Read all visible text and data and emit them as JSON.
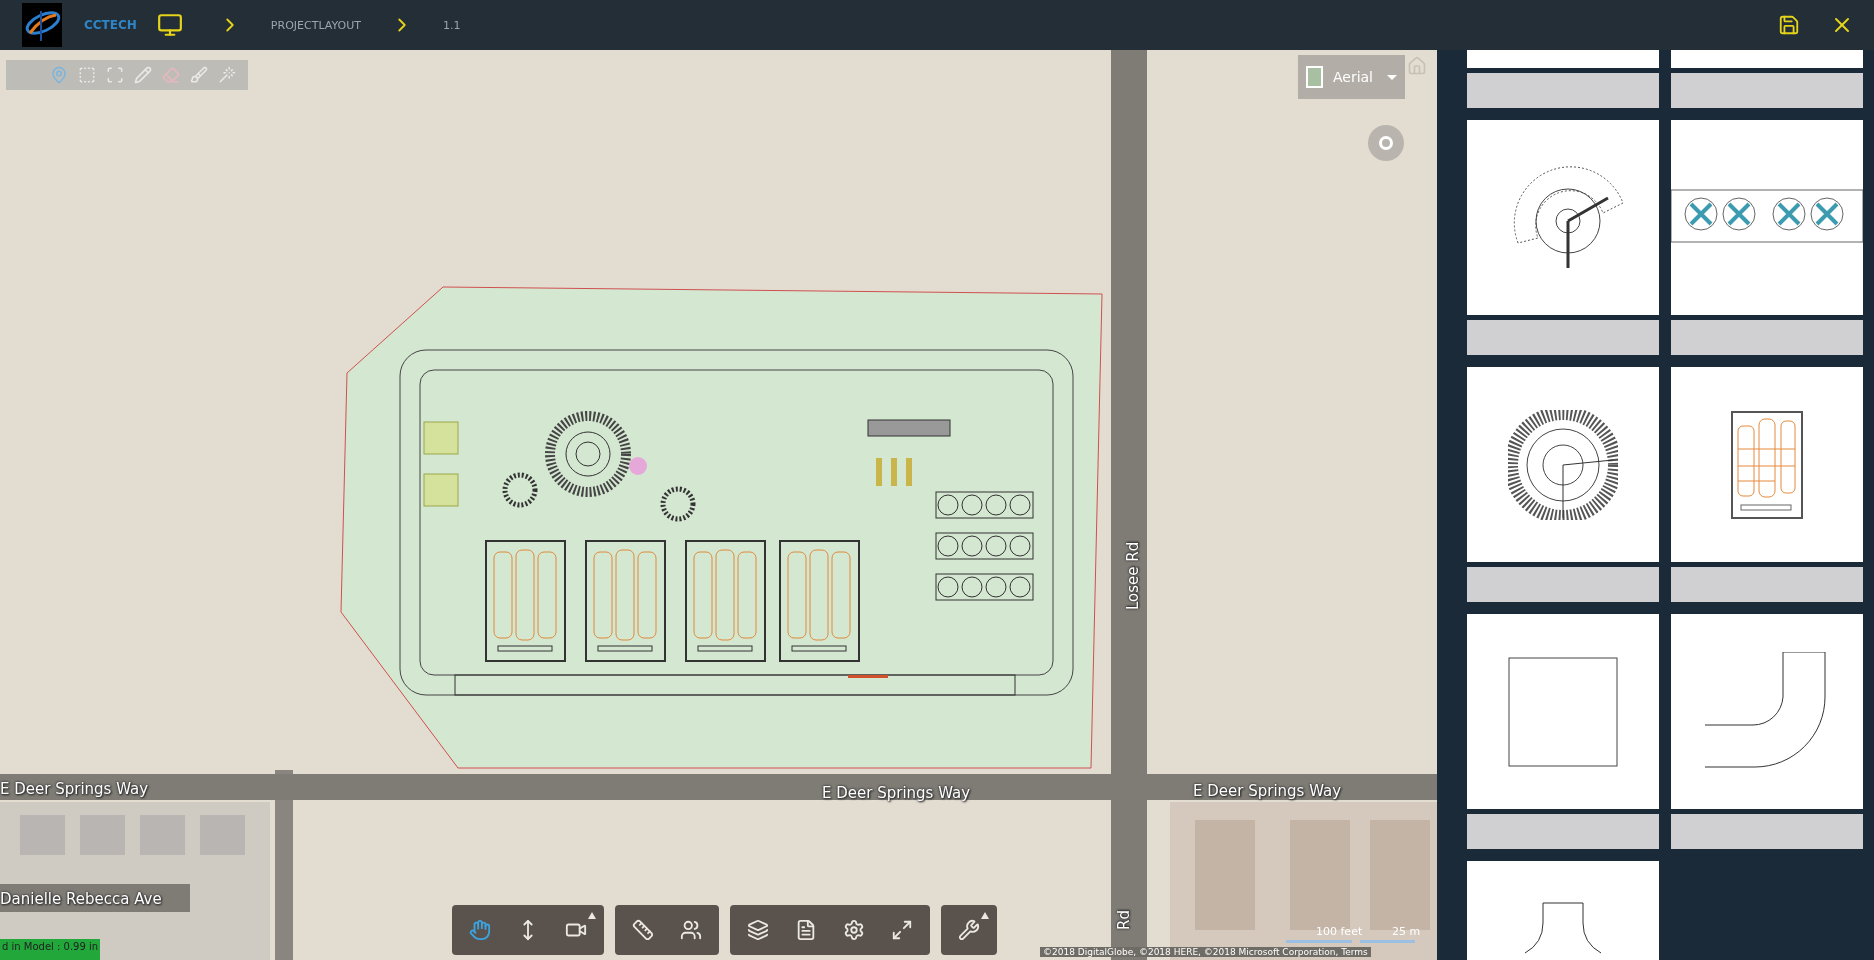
{
  "header": {
    "brand": "CCTECH",
    "breadcrumbs": [
      "PROJECTLAYOUT",
      "1.1"
    ]
  },
  "map": {
    "layer_select": {
      "value": "Aerial"
    },
    "draw_tools": [
      {
        "kind": "pin"
      },
      {
        "kind": "select"
      },
      {
        "kind": "frame"
      },
      {
        "kind": "pencil"
      },
      {
        "kind": "eraser"
      },
      {
        "kind": "brush"
      },
      {
        "kind": "wand"
      }
    ],
    "streets": [
      "E Deer Springs Way",
      "E Deer Springs Way",
      "E Deer Springs Way",
      "Losee Rd",
      "Danielle Rebecca Ave",
      "Rd"
    ],
    "scale": {
      "feet": "100 feet",
      "meters": "25 m"
    },
    "attribution": "©2018 DigitalGlobe, ©2018 HERE, ©2018 Microsoft Corporation, Terms",
    "status": "d in Model : 0.99 in"
  },
  "toolbar": {
    "groups": [
      {
        "tools": [
          {
            "kind": "pan",
            "selected": true
          },
          {
            "kind": "elevate",
            "selected": false
          },
          {
            "kind": "camera",
            "selected": false
          }
        ]
      },
      {
        "tools": [
          {
            "kind": "ruler",
            "selected": false
          },
          {
            "kind": "people",
            "selected": false
          }
        ]
      },
      {
        "tools": [
          {
            "kind": "layers",
            "selected": false
          },
          {
            "kind": "report",
            "selected": false
          },
          {
            "kind": "settings",
            "selected": false
          },
          {
            "kind": "expand",
            "selected": false
          }
        ]
      },
      {
        "tools": [
          {
            "kind": "wrench",
            "selected": false
          }
        ]
      }
    ]
  },
  "panel": {
    "cards": [
      {
        "kind": "blank"
      },
      {
        "kind": "blank"
      },
      {
        "kind": "tank-ring"
      },
      {
        "kind": "fan-row"
      },
      {
        "kind": "tank"
      },
      {
        "kind": "bay"
      },
      {
        "kind": "square"
      },
      {
        "kind": "elbow"
      },
      {
        "kind": "funnel"
      }
    ]
  }
}
